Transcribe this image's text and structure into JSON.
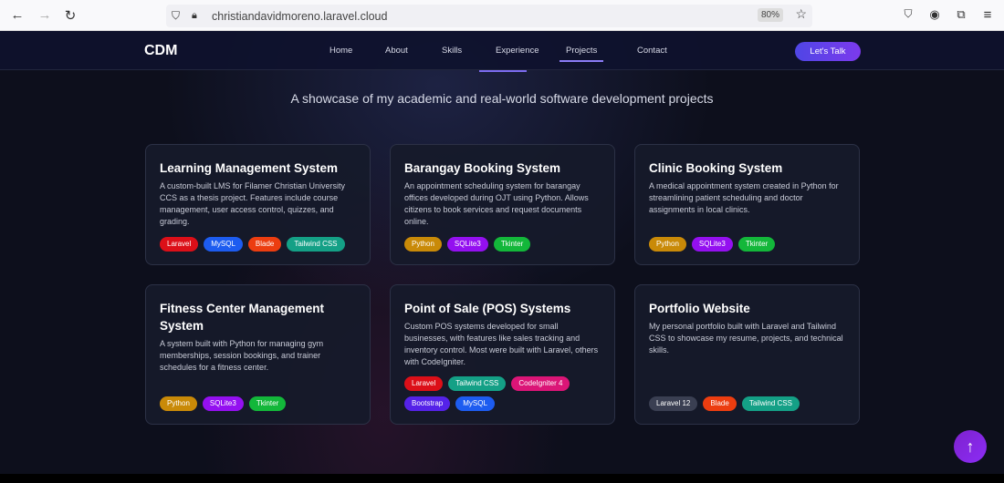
{
  "browser": {
    "url": "christiandavidmoreno.laravel.cloud",
    "zoom": "80%"
  },
  "nav": {
    "logo": "CDM",
    "links": [
      "Home",
      "About",
      "Skills",
      "Experience",
      "Projects",
      "Contact"
    ],
    "active": "Projects",
    "cta": "Let's Talk"
  },
  "subtitle": "A showcase of my academic and real-world software development projects",
  "tag_colors": {
    "Laravel": "#dc0f18",
    "MySQL": "#1d5cf0",
    "Blade": "#ec3d10",
    "Tailwind CSS": "#14a086",
    "Python": "#c98a08",
    "SQLite3": "#9410f0",
    "Tkinter": "#13b73a",
    "CodeIgniter 4": "#db1577",
    "Bootstrap": "#5522e8",
    "Laravel 12": "#3a3f52"
  },
  "projects": [
    {
      "title": "Learning Management System",
      "description": "A custom-built LMS for Filamer Christian University CCS as a thesis project. Features include course management, user access control, quizzes, and grading.",
      "tags": [
        "Laravel",
        "MySQL",
        "Blade",
        "Tailwind CSS"
      ]
    },
    {
      "title": "Barangay Booking System",
      "description": "An appointment scheduling system for barangay offices developed during OJT using Python. Allows citizens to book services and request documents online.",
      "tags": [
        "Python",
        "SQLite3",
        "Tkinter"
      ]
    },
    {
      "title": "Clinic Booking System",
      "description": "A medical appointment system created in Python for streamlining patient scheduling and doctor assignments in local clinics.",
      "tags": [
        "Python",
        "SQLite3",
        "Tkinter"
      ]
    },
    {
      "title": "Fitness Center Management System",
      "description": "A system built with Python for managing gym memberships, session bookings, and trainer schedules for a fitness center.",
      "tags": [
        "Python",
        "SQLite3",
        "Tkinter"
      ]
    },
    {
      "title": "Point of Sale (POS) Systems",
      "description": "Custom POS systems developed for small businesses, with features like sales tracking and inventory control. Most were built with Laravel, others with CodeIgniter.",
      "tags": [
        "Laravel",
        "Tailwind CSS",
        "CodeIgniter 4",
        "Bootstrap",
        "MySQL"
      ]
    },
    {
      "title": "Portfolio Website",
      "description": "My personal portfolio built with Laravel and Tailwind CSS to showcase my resume, projects, and technical skills.",
      "tags": [
        "Laravel 12",
        "Blade",
        "Tailwind CSS"
      ]
    }
  ]
}
